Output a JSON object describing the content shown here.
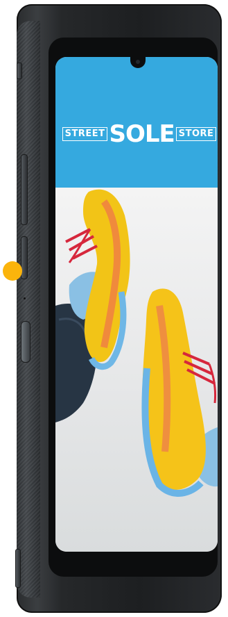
{
  "store_logo": {
    "left_word": "STREET",
    "center_word": "SOLE",
    "right_word": "STORE"
  },
  "colors": {
    "banner": "#35a9df",
    "indicator": "#fbb40c",
    "device_body": "#1d1f21"
  },
  "icons": {
    "indicator": "indicator-dot-icon",
    "front_camera": "camera-icon"
  }
}
